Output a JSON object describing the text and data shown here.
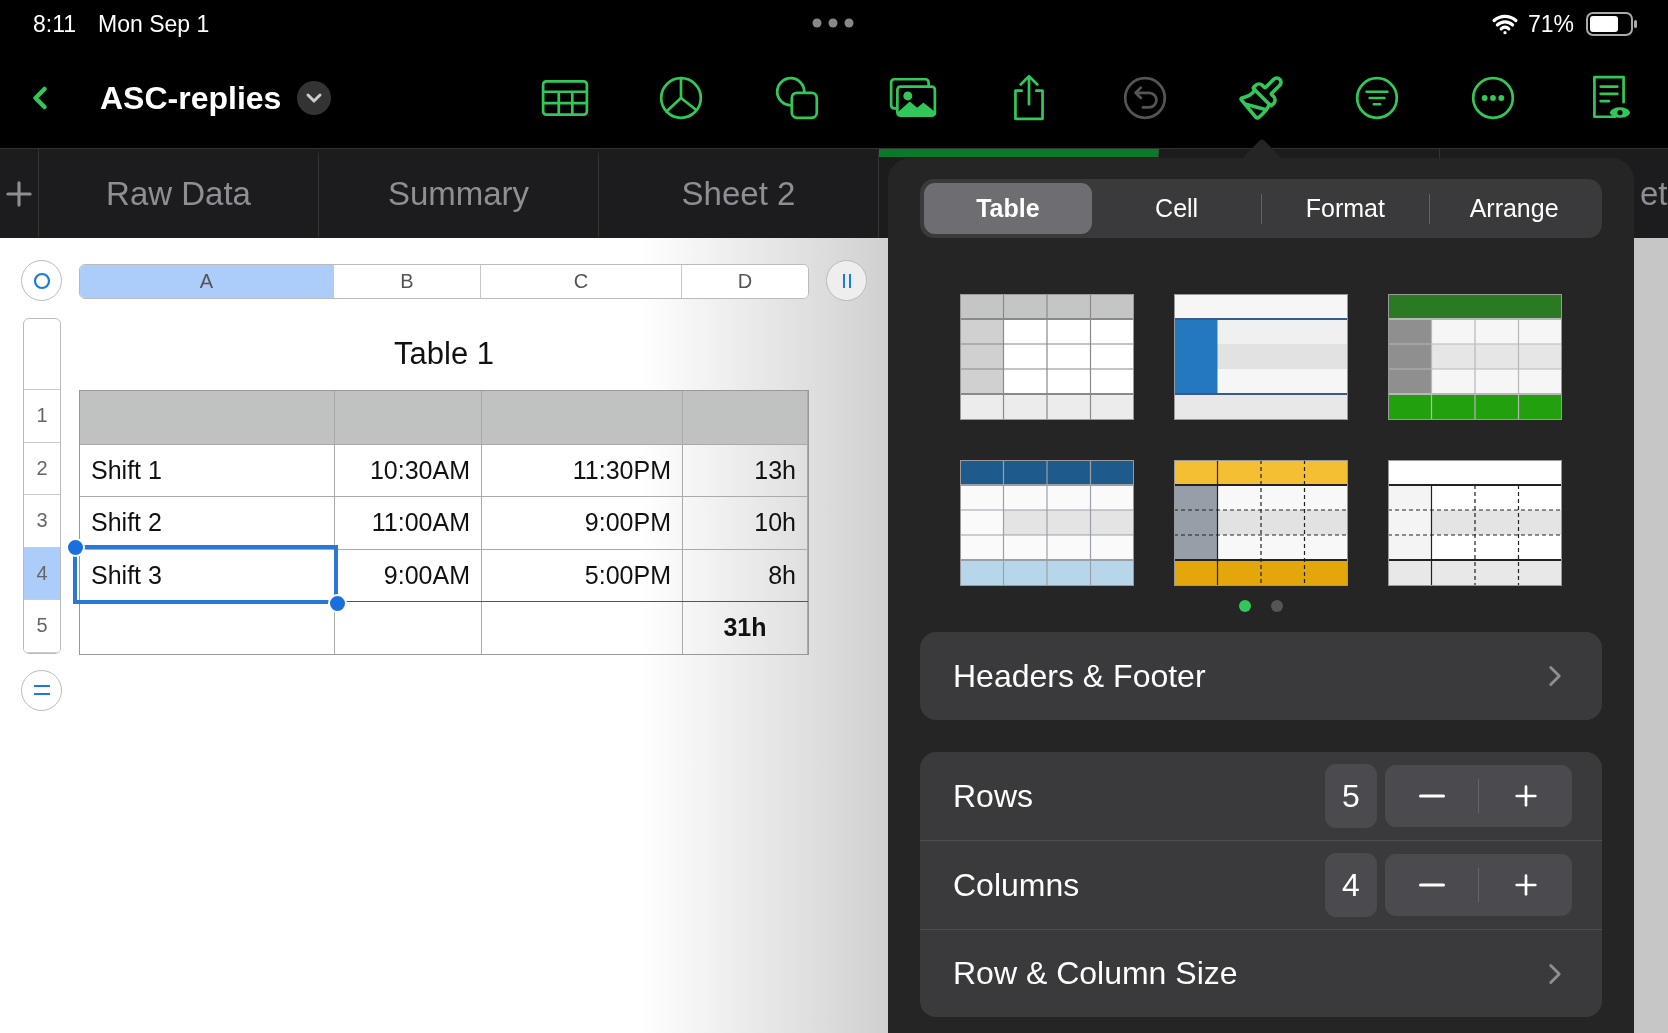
{
  "status_bar": {
    "time": "8:11",
    "date": "Mon Sep 1",
    "battery": "71%"
  },
  "toolbar": {
    "title": "ASC-replies",
    "buttons": [
      {
        "kind": "table",
        "disabled": false
      },
      {
        "kind": "chart",
        "disabled": false
      },
      {
        "kind": "shape",
        "disabled": false
      },
      {
        "kind": "media",
        "disabled": false
      },
      {
        "kind": "share",
        "disabled": false
      },
      {
        "kind": "undo",
        "disabled": true
      },
      {
        "kind": "format",
        "disabled": false
      },
      {
        "kind": "filter",
        "disabled": false
      },
      {
        "kind": "more",
        "disabled": false
      },
      {
        "kind": "reader",
        "disabled": false
      }
    ]
  },
  "sheet_tabs": [
    {
      "kind": "tab",
      "label": "Raw Data",
      "selected": false
    },
    {
      "kind": "tab",
      "label": "Summary",
      "selected": false
    },
    {
      "kind": "tab",
      "label": "Sheet 2",
      "selected": false
    },
    {
      "kind": "tab",
      "selected": true
    },
    {
      "kind": "cut",
      "label": "et",
      "selected": false
    }
  ],
  "table": {
    "title": "Table 1",
    "columns": [
      {
        "label": "A",
        "selected": true
      },
      {
        "label": "B",
        "selected": false
      },
      {
        "label": "C",
        "selected": false
      },
      {
        "label": "D",
        "selected": false
      }
    ],
    "rows": [
      {
        "kind": "header",
        "label": "1",
        "selected": false
      },
      {
        "kind": "body",
        "label": "2",
        "selected": false,
        "cells": [
          "Shift 1",
          "10:30AM",
          "11:30PM",
          "13h"
        ]
      },
      {
        "kind": "body",
        "label": "3",
        "selected": false,
        "cells": [
          "Shift 2",
          "11:00AM",
          "9:00PM",
          "10h"
        ]
      },
      {
        "kind": "body",
        "label": "4",
        "selected": true,
        "cells": [
          "Shift 3",
          "9:00AM",
          "5:00PM",
          "8h"
        ]
      },
      {
        "kind": "footer",
        "label": "5",
        "selected": false,
        "total": "31h"
      }
    ]
  },
  "inspector": {
    "segments": [
      {
        "label": "Table",
        "selected": true
      },
      {
        "label": "Cell",
        "selected": false
      },
      {
        "label": "Format",
        "selected": false
      },
      {
        "label": "Arrange",
        "selected": false
      }
    ],
    "styles": [
      {
        "kind": "gray",
        "color": "#c4c5c5"
      },
      {
        "kind": "sidebar",
        "color": "#2478be"
      },
      {
        "kind": "green",
        "color": "#2a7a24"
      },
      {
        "kind": "navy",
        "color": "#1f5a8c"
      },
      {
        "kind": "amber",
        "color": "#f5bf33"
      },
      {
        "kind": "outline",
        "color": "#f4f4f4"
      }
    ],
    "pages": [
      {
        "selected": true
      },
      {
        "selected": false
      }
    ],
    "headers_footer": "Headers & Footer",
    "rows": {
      "label": "Rows",
      "value": "5"
    },
    "columns": {
      "label": "Columns",
      "value": "4"
    },
    "size": "Row & Column Size"
  }
}
